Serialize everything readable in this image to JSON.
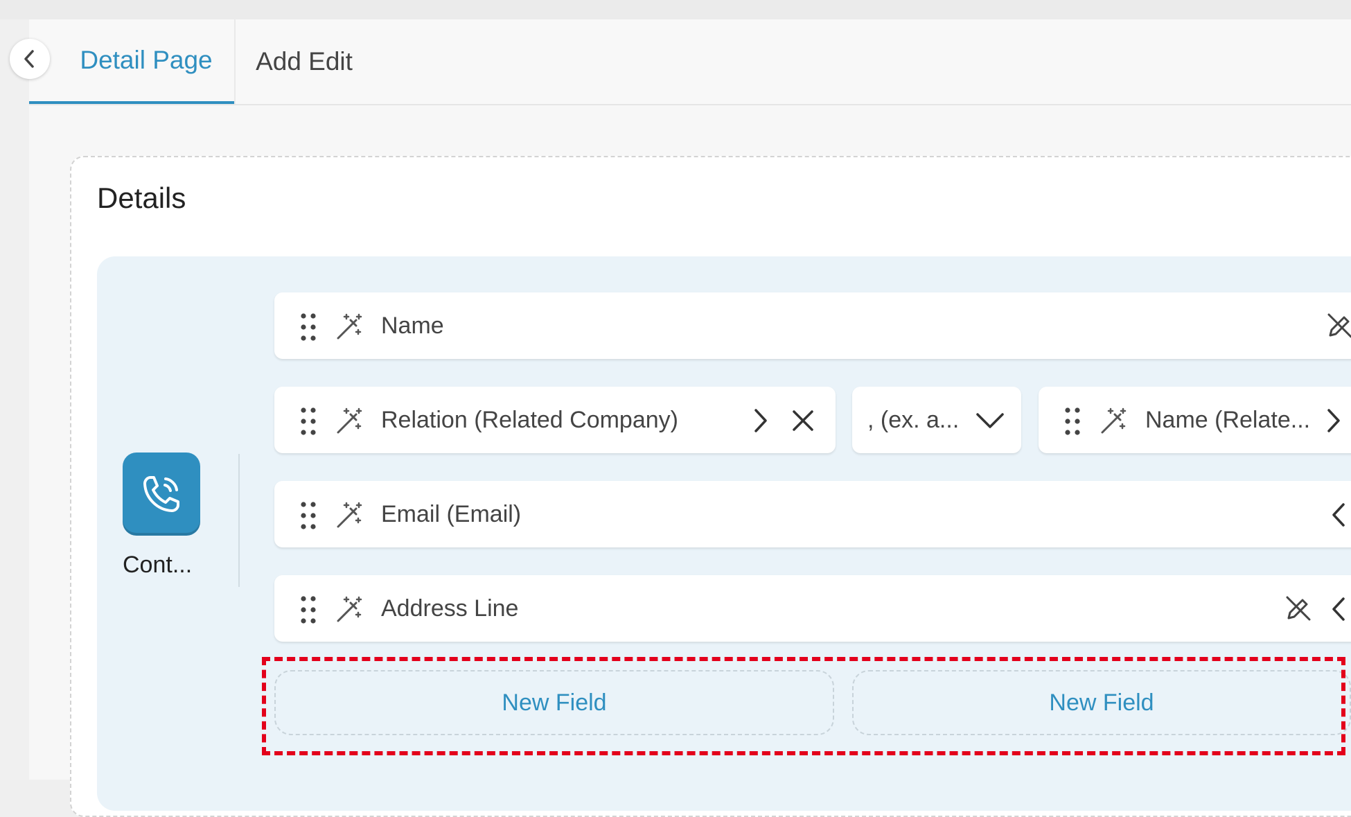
{
  "tabs": [
    {
      "label": "Detail Page",
      "active": true
    },
    {
      "label": "Add Edit",
      "active": false
    }
  ],
  "section": {
    "title": "Details",
    "contact_label": "Cont..."
  },
  "fields": {
    "name": "Name",
    "relation": "Relation (Related Company)",
    "separator": ", (ex. a...",
    "related_name": "Name (Relate...",
    "email": "Email (Email)",
    "address": "Address Line"
  },
  "new_field_label": "New Field",
  "colors": {
    "accent": "#2f8fc0",
    "highlight": "#e3001b",
    "panel": "#eaf3f9"
  },
  "icons": [
    "chevron-left-icon",
    "drag-handle-icon",
    "magic-wand-icon",
    "pencil-off-icon",
    "chevron-right-icon",
    "close-icon",
    "chevron-down-icon",
    "phone-icon"
  ]
}
